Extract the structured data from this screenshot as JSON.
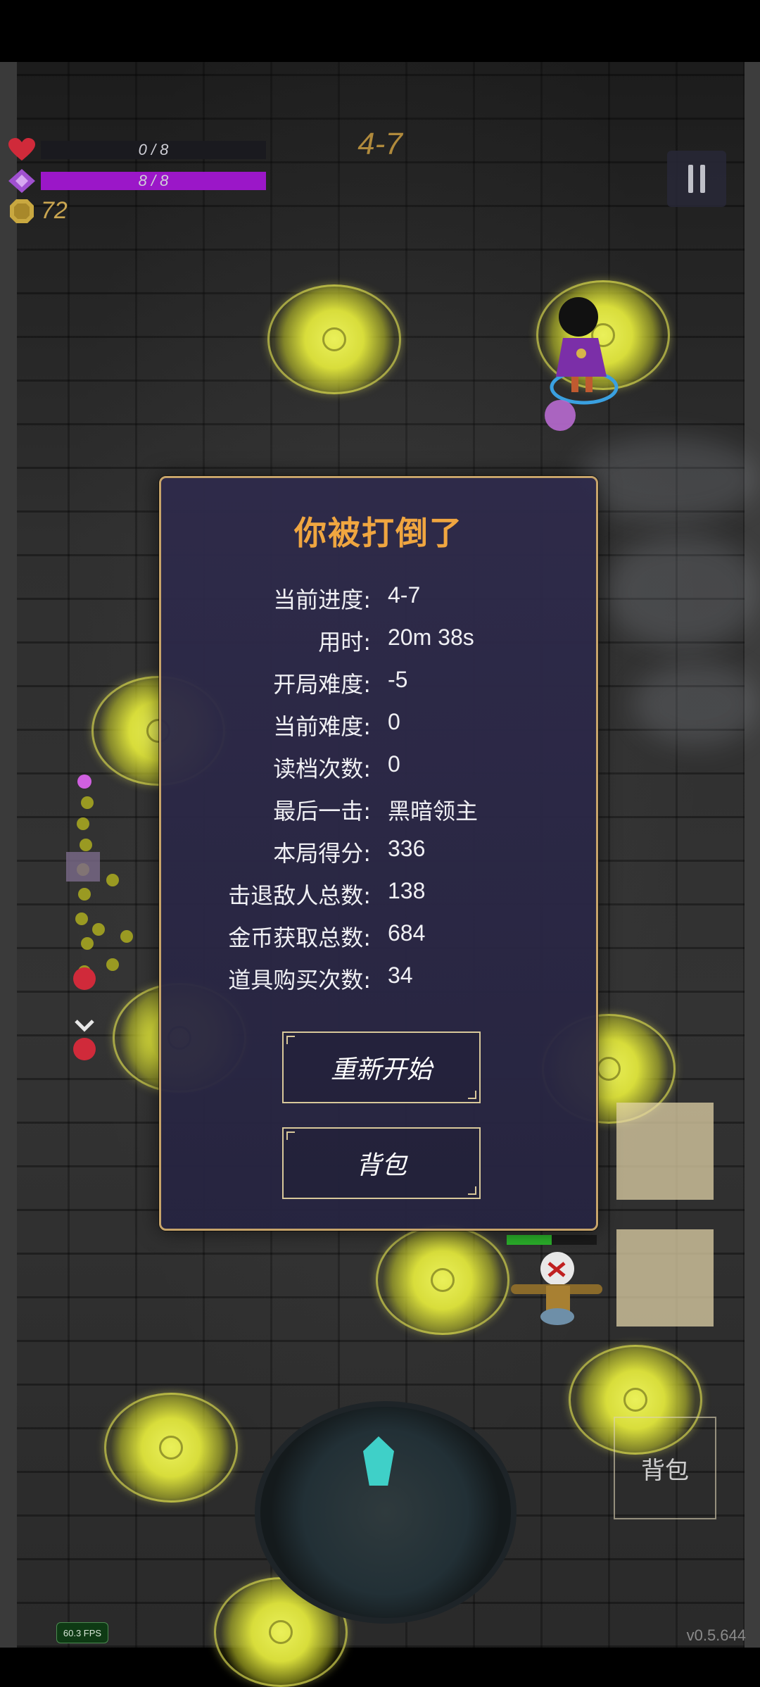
{
  "hud": {
    "health_text": "0 / 8",
    "health_fraction": 0,
    "mana_text": "8 / 8",
    "mana_fraction": 1,
    "coins": "72",
    "level": "4-7"
  },
  "dialog": {
    "title": "你被打倒了",
    "stats": [
      {
        "label": "当前进度:",
        "value": "4-7"
      },
      {
        "label": "用时:",
        "value": "20m 38s"
      },
      {
        "label": "开局难度:",
        "value": "-5"
      },
      {
        "label": "当前难度:",
        "value": "0"
      },
      {
        "label": "读档次数:",
        "value": "0"
      },
      {
        "label": "最后一击:",
        "value": "黑暗领主"
      },
      {
        "label": "本局得分:",
        "value": "336"
      },
      {
        "label": "击退敌人总数:",
        "value": "138"
      },
      {
        "label": "金币获取总数:",
        "value": "684"
      },
      {
        "label": "道具购买次数:",
        "value": "34"
      }
    ],
    "restart_label": "重新开始",
    "bag_label": "背包"
  },
  "bag_button_label": "背包",
  "fps": "60.3 FPS",
  "version": "v0.5.644",
  "colors": {
    "health": "#d02a3a",
    "mana": "#9b17c8",
    "title": "#f0a640",
    "level": "#b08a3c"
  }
}
